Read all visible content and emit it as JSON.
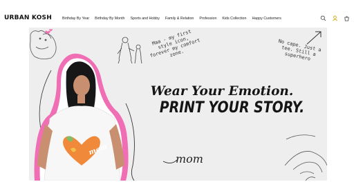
{
  "brand": {
    "logo": "URBAN KOSH"
  },
  "nav": {
    "items": [
      "Birthday By Year",
      "Birthday By Month",
      "Sports and Hobby",
      "Family & Relation",
      "Profession",
      "Kids Collection",
      "Happy Customers"
    ]
  },
  "header_icons": [
    "search-icon",
    "user-icon",
    "cart-icon"
  ],
  "hero": {
    "headline_line1": "Wear Your Emotion.",
    "headline_line2": "PRINT YOUR STORY.",
    "note_left": "Maa - my first style icon, forever my comfort zone.",
    "note_right": "No cape. Just a tee. Still a superhero",
    "script_word": "mom",
    "shirt_text": "mom"
  },
  "colors": {
    "hero_bg": "#eeeeee",
    "accent_pink": "#f06eb4",
    "heart_orange": "#f08a3a"
  }
}
